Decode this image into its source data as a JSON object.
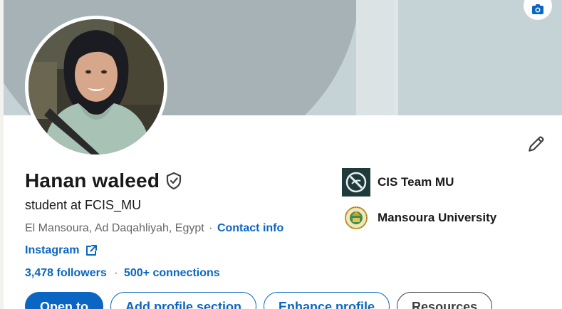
{
  "profile": {
    "name": "Hanan waleed",
    "headline": "student at FCIS_MU",
    "location": "El Mansoura, Ad Daqahliyah, Egypt",
    "location_separator": "·",
    "contact_info_label": "Contact info",
    "website_label": "Instagram",
    "followers_label": "3,478 followers",
    "stats_separator": "·",
    "connections_label": "500+ connections"
  },
  "organizations": [
    {
      "name": "CIS Team MU",
      "logo": "cis-team-logo"
    },
    {
      "name": "Mansoura University",
      "logo": "mansoura-university-seal"
    }
  ],
  "actions": {
    "open_to": "Open to",
    "add_section": "Add profile section",
    "enhance": "Enhance profile",
    "resources": "Resources"
  },
  "icons": {
    "camera": "camera-icon",
    "edit": "pencil-icon",
    "verified": "verified-shield-icon",
    "external_link": "external-link-icon"
  },
  "colors": {
    "accent": "#0a66c2",
    "banner": "#c6d3d6",
    "banner_arc": "#a6b2b5"
  }
}
